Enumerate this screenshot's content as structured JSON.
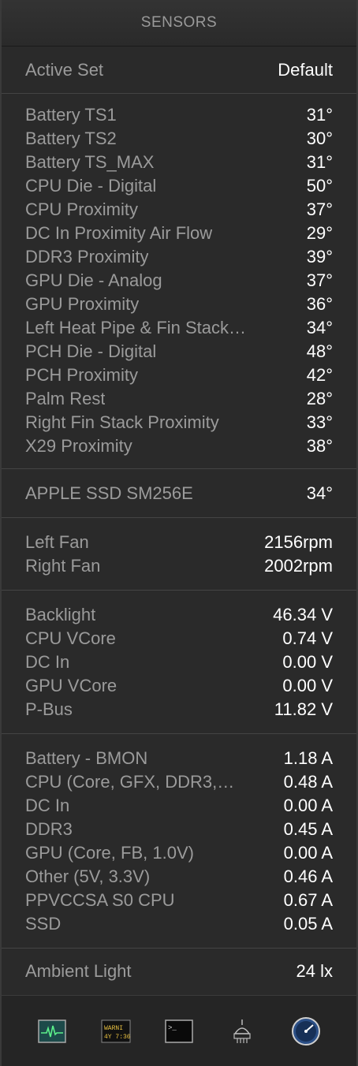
{
  "title": "SENSORS",
  "active_set": {
    "label": "Active Set",
    "value": "Default"
  },
  "temperatures": [
    {
      "label": "Battery TS1",
      "value": "31°"
    },
    {
      "label": "Battery TS2",
      "value": "30°"
    },
    {
      "label": "Battery TS_MAX",
      "value": "31°"
    },
    {
      "label": "CPU Die - Digital",
      "value": "50°"
    },
    {
      "label": "CPU Proximity",
      "value": "37°"
    },
    {
      "label": "DC In Proximity Air Flow",
      "value": "29°"
    },
    {
      "label": "DDR3 Proximity",
      "value": "39°"
    },
    {
      "label": "GPU Die - Analog",
      "value": "37°"
    },
    {
      "label": "GPU Proximity",
      "value": "36°"
    },
    {
      "label": "Left Heat Pipe & Fin Stack…",
      "value": "34°"
    },
    {
      "label": "PCH Die - Digital",
      "value": "48°"
    },
    {
      "label": "PCH Proximity",
      "value": "42°"
    },
    {
      "label": "Palm Rest",
      "value": "28°"
    },
    {
      "label": "Right Fin Stack Proximity",
      "value": "33°"
    },
    {
      "label": "X29 Proximity",
      "value": "38°"
    }
  ],
  "disks": [
    {
      "label": "APPLE SSD SM256E",
      "value": "34°"
    }
  ],
  "fans": [
    {
      "label": "Left Fan",
      "value": "2156rpm"
    },
    {
      "label": "Right Fan",
      "value": "2002rpm"
    }
  ],
  "voltages": [
    {
      "label": "Backlight",
      "value": "46.34 V"
    },
    {
      "label": "CPU VCore",
      "value": "0.74 V"
    },
    {
      "label": "DC In",
      "value": "0.00 V"
    },
    {
      "label": "GPU VCore",
      "value": "0.00 V"
    },
    {
      "label": "P-Bus",
      "value": "11.82 V"
    }
  ],
  "currents": [
    {
      "label": "Battery - BMON",
      "value": "1.18 A"
    },
    {
      "label": "CPU (Core, GFX, DDR3,…",
      "value": "0.48 A"
    },
    {
      "label": "DC In",
      "value": "0.00 A"
    },
    {
      "label": "DDR3",
      "value": "0.45 A"
    },
    {
      "label": "GPU (Core, FB, 1.0V)",
      "value": "0.00 A"
    },
    {
      "label": "Other (5V, 3.3V)",
      "value": "0.46 A"
    },
    {
      "label": "PPVCCSA S0 CPU",
      "value": "0.67 A"
    },
    {
      "label": "SSD",
      "value": "0.05 A"
    }
  ],
  "light": [
    {
      "label": "Ambient Light",
      "value": "24 lx"
    }
  ],
  "toolbar": {
    "console_icon_text_1": "WARNI",
    "console_icon_text_2": "4Y 7:36",
    "terminal_prompt": ">_"
  }
}
